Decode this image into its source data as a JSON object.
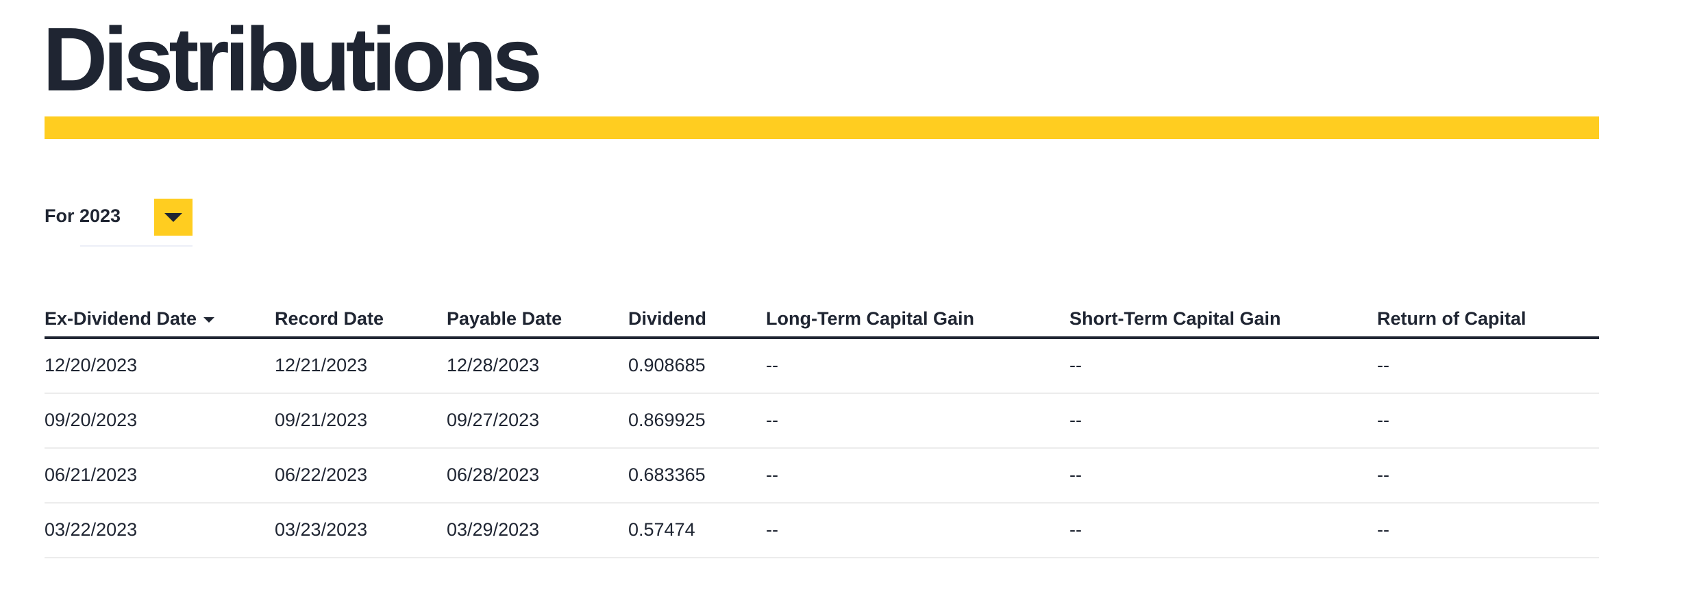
{
  "page_title": "Distributions",
  "colors": {
    "accent": "#ffcd20",
    "text": "#1f2532"
  },
  "filter": {
    "label": "For 2023",
    "icon": "caret-down-icon"
  },
  "table": {
    "headers": [
      "Ex-Dividend Date",
      "Record Date",
      "Payable Date",
      "Dividend",
      "Long-Term Capital Gain",
      "Short-Term Capital Gain",
      "Return of Capital"
    ],
    "rows": [
      [
        "12/20/2023",
        "12/21/2023",
        "12/28/2023",
        "0.908685",
        "--",
        "--",
        "--"
      ],
      [
        "09/20/2023",
        "09/21/2023",
        "09/27/2023",
        "0.869925",
        "--",
        "--",
        "--"
      ],
      [
        "06/21/2023",
        "06/22/2023",
        "06/28/2023",
        "0.683365",
        "--",
        "--",
        "--"
      ],
      [
        "03/22/2023",
        "03/23/2023",
        "03/29/2023",
        "0.57474",
        "--",
        "--",
        "--"
      ]
    ]
  }
}
